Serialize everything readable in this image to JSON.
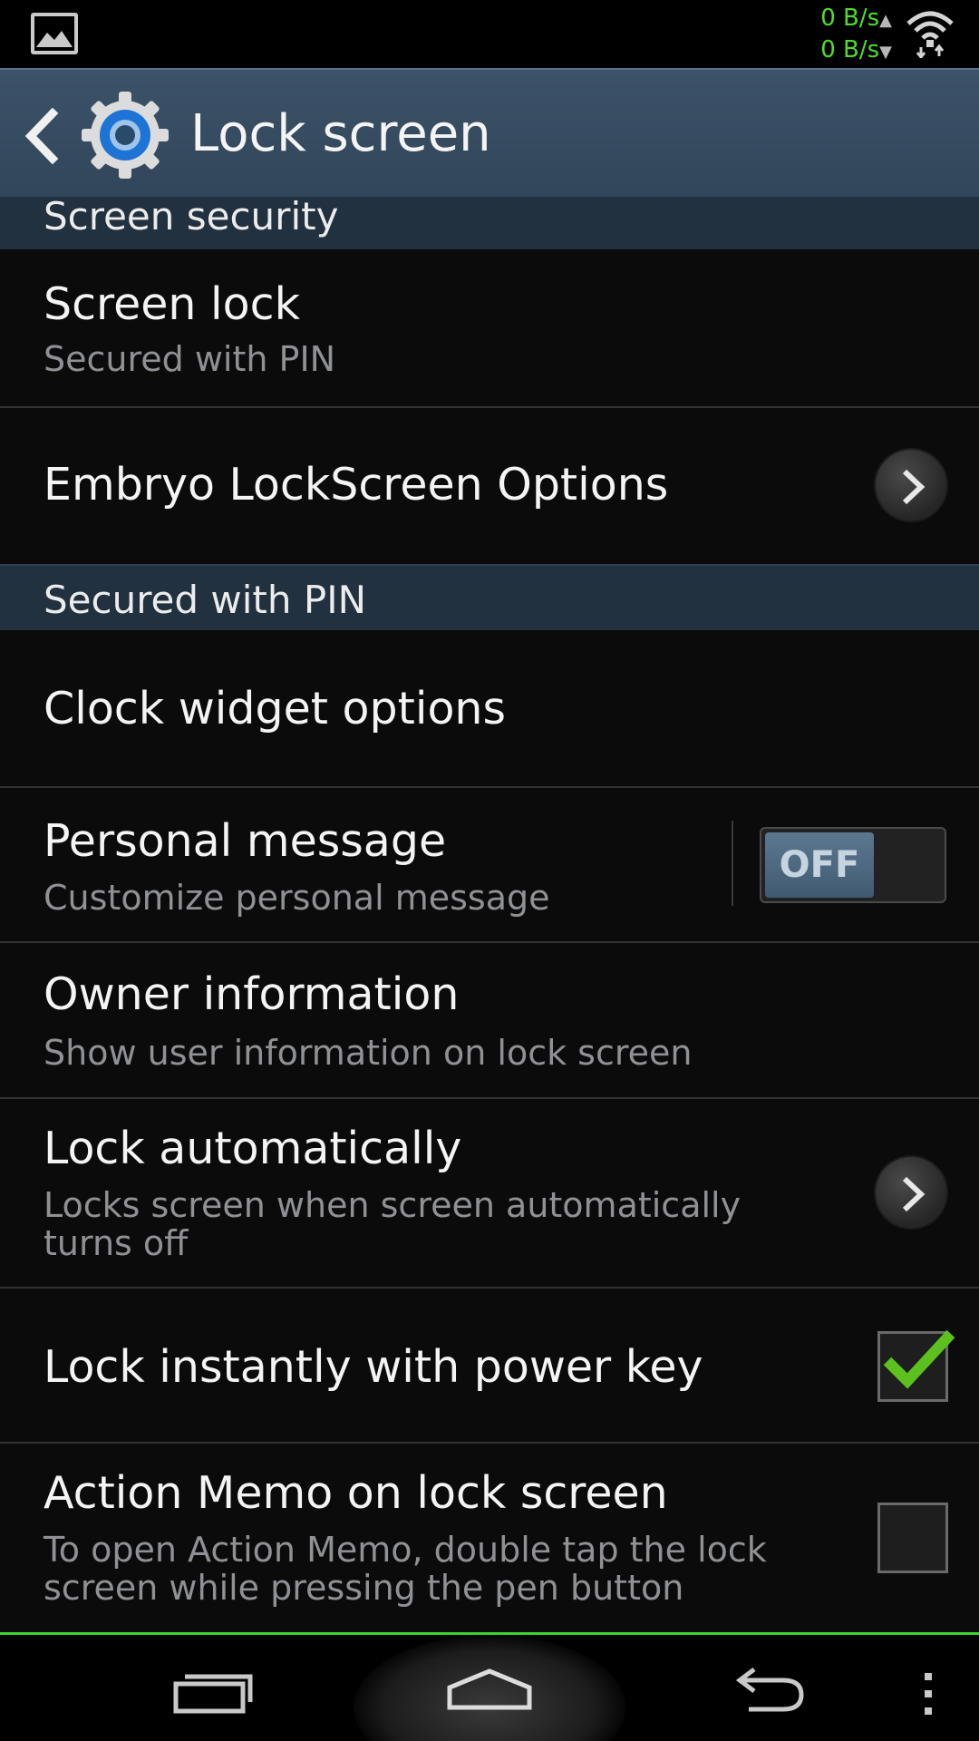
{
  "status_bar": {
    "upload_speed": "0 B/s",
    "download_speed": "0 B/s",
    "icons": [
      "gallery-icon",
      "wifi-icon"
    ]
  },
  "action_bar": {
    "title": "Lock screen",
    "icons": [
      "back-icon",
      "settings-gear-icon"
    ]
  },
  "sections": [
    {
      "header": "Screen security",
      "items": [
        {
          "title": "Screen lock",
          "subtitle": "Secured with PIN"
        },
        {
          "title": "Embryo LockScreen Options",
          "control": "chevron"
        }
      ]
    },
    {
      "header": "Secured with PIN",
      "items": [
        {
          "title": "Clock widget options"
        },
        {
          "title": "Personal message",
          "subtitle": "Customize personal message",
          "control": "toggle",
          "toggle_label": "OFF",
          "toggle_on": false
        },
        {
          "title": "Owner information",
          "subtitle": "Show user information on lock screen"
        },
        {
          "title": "Lock automatically",
          "subtitle": "Locks screen when screen automatically turns off",
          "control": "chevron"
        },
        {
          "title": "Lock instantly with power key",
          "control": "checkbox",
          "checked": true
        },
        {
          "title": "Action Memo on lock screen",
          "subtitle": "To open Action Memo, double tap the lock screen while pressing the pen button",
          "control": "checkbox",
          "checked": false
        }
      ]
    }
  ],
  "nav_bar": {
    "icons": [
      "recent-apps-icon",
      "home-icon",
      "back-nav-icon",
      "menu-icon"
    ]
  },
  "colors": {
    "action_bar": "#36495c",
    "section_header": "#22313f",
    "net_speed": "#4fdc2c",
    "check_green": "#5cc11e",
    "nav_accent": "#39d52c"
  }
}
